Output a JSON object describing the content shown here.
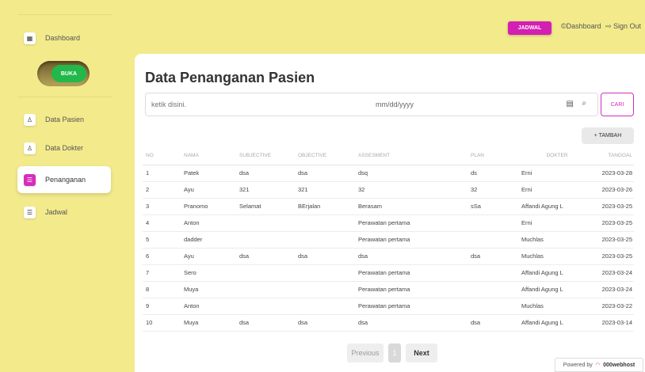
{
  "sidebar": {
    "dashboard_label": "Dashboard",
    "toggle_label": "BUKA",
    "items": [
      {
        "label": "Data Pasien",
        "icon": "user-plus-icon"
      },
      {
        "label": "Data Dokter",
        "icon": "user-plus-icon"
      },
      {
        "label": "Penanganan",
        "icon": "list-icon"
      },
      {
        "label": "Jadwal",
        "icon": "list-icon"
      }
    ]
  },
  "topbar": {
    "jadwal_label": "JADWAL",
    "dashboard_label": "©Dashboard",
    "signout_label": "⇨ Sign Out"
  },
  "main": {
    "title": "Data Penanganan Pasien",
    "search_placeholder": "ketik disini.",
    "date_placeholder": "mm/dd/yyyy",
    "cari_label": "CARI",
    "tambah_label": "+ TAMBAH",
    "columns": [
      "NO",
      "NAMA",
      "SUBJECTIVE",
      "OBJECTIVE",
      "ASSESMENT",
      "PLAN",
      "DOKTER",
      "TANGGAL"
    ],
    "rows": [
      [
        "1",
        "Patek",
        "dsa",
        "dsa",
        "dsq",
        "ds",
        "Erni",
        "2023-03-28"
      ],
      [
        "2",
        "Ayu",
        "321",
        "321",
        "32",
        "32",
        "Erni",
        "2023-03-26"
      ],
      [
        "3",
        "Pranomo",
        "Selamat",
        "BErjalan",
        "Berasam",
        "sSa",
        "Affandi Agung L",
        "2023-03-25"
      ],
      [
        "4",
        "Anton",
        "",
        "",
        "Perawatan pertama",
        "",
        "Erni",
        "2023-03-25"
      ],
      [
        "5",
        "dadder",
        "",
        "",
        "Perawatan pertama",
        "",
        "Muchlas",
        "2023-03-25"
      ],
      [
        "6",
        "Ayu",
        "dsa",
        "dsa",
        "dsa",
        "dsa",
        "Muchlas",
        "2023-03-25"
      ],
      [
        "7",
        "Sero",
        "",
        "",
        "Perawatan pertama",
        "",
        "Affandi Agung L",
        "2023-03-24"
      ],
      [
        "8",
        "Muya",
        "",
        "",
        "Perawatan pertama",
        "",
        "Affandi Agung L",
        "2023-03-24"
      ],
      [
        "9",
        "Anton",
        "",
        "",
        "Perawatan pertama",
        "",
        "Muchlas",
        "2023-03-22"
      ],
      [
        "10",
        "Muya",
        "dsa",
        "dsa",
        "dsa",
        "dsa",
        "Affandi Agung L",
        "2023-03-14"
      ]
    ],
    "pagination": {
      "prev_label": "Previous",
      "current_page": "1",
      "next_label": "Next"
    }
  },
  "footer": {
    "powered_label": "Powered by",
    "brand": "000webhost"
  },
  "colors": {
    "background": "#f3ea8c",
    "accent": "#d31fb3",
    "toggle_green": "#22b84a"
  }
}
